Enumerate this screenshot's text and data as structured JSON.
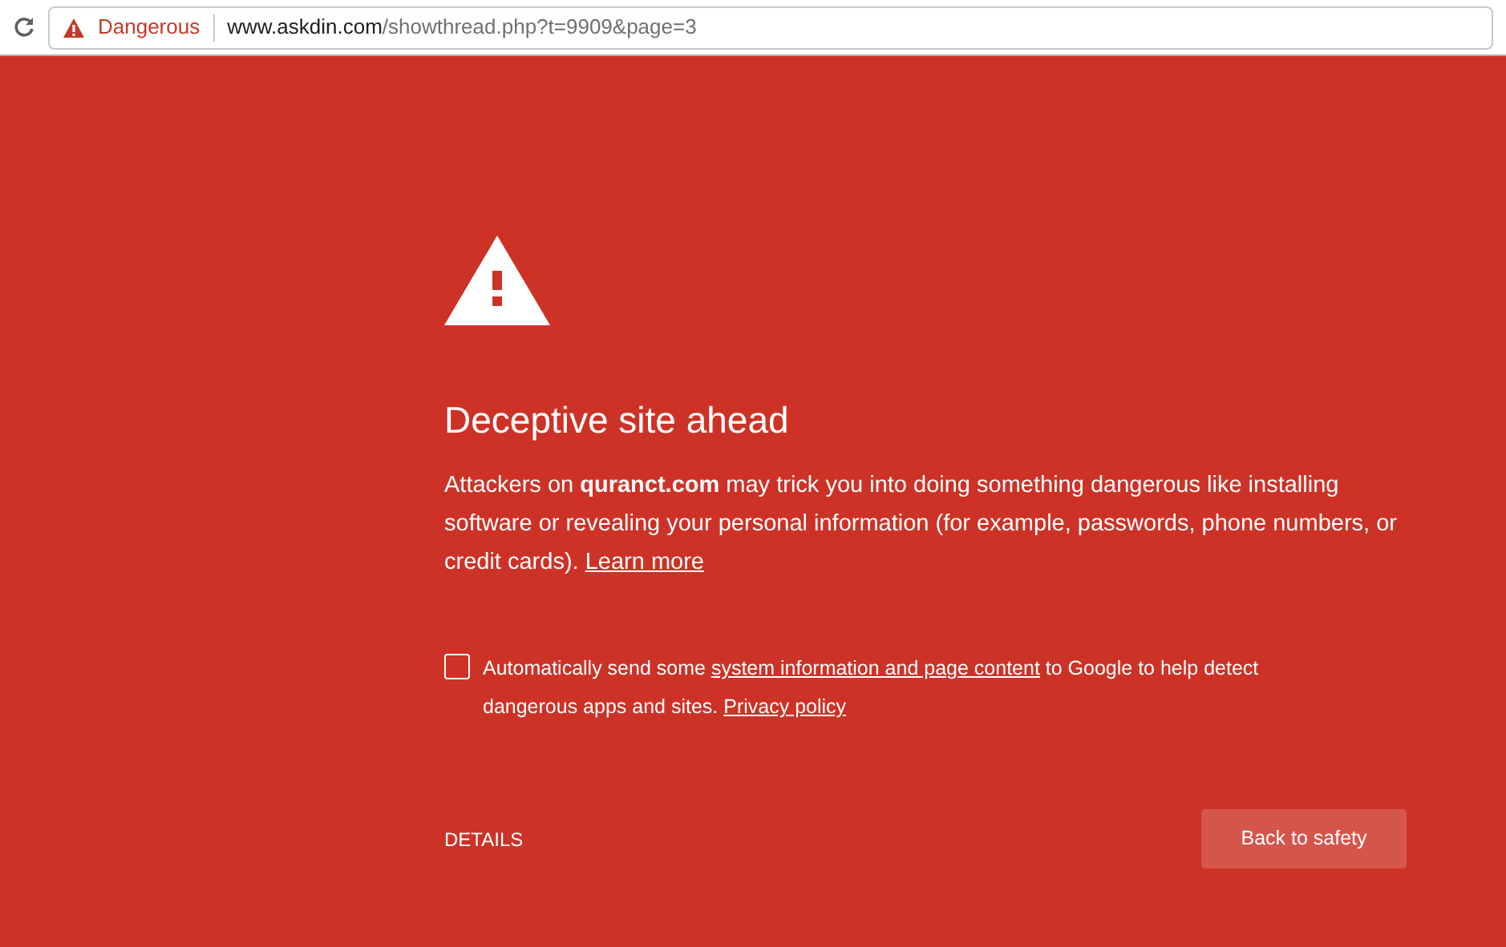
{
  "toolbar": {
    "security_label": "Dangerous",
    "url_host": "www.askdin.com",
    "url_path": "/showthread.php?t=9909&page=3"
  },
  "interstitial": {
    "heading": "Deceptive site ahead",
    "body": "Attackers on **quranct.com** may trick you into doing something dangerous like installing software or revealing your personal information (for example, passwords, phone numbers, or credit cards).",
    "learn_more": "Learn more",
    "report": {
      "checked": false,
      "text_before": "Automatically send some",
      "link": "system information and page content",
      "text_after": "to Google to help detect dangerous apps and sites.",
      "privacy_link": "Privacy policy"
    },
    "details": "DETAILS",
    "back_button": "Back to safety"
  }
}
